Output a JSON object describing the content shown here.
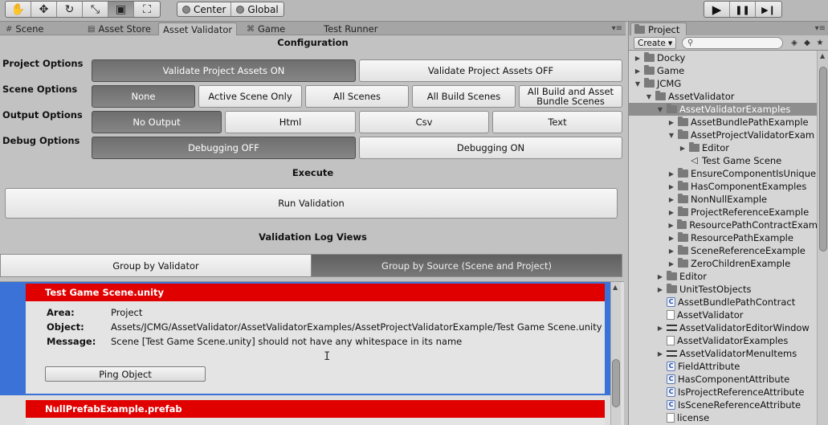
{
  "toolbar": {
    "transform_tools": [
      {
        "icon": "hand-icon",
        "glyph": "✋"
      },
      {
        "icon": "move-icon",
        "glyph": "✥"
      },
      {
        "icon": "rotate-icon",
        "glyph": "↻"
      },
      {
        "icon": "scale-icon",
        "glyph": "⤡"
      },
      {
        "icon": "rect-icon",
        "glyph": "▣"
      },
      {
        "icon": "transform-icon",
        "glyph": "⛶"
      }
    ],
    "pivot": "Center",
    "space": "Global",
    "play_glyph": "▶",
    "pause_glyph": "❚❚",
    "step_glyph": "▶❙"
  },
  "tabs": {
    "scene": "Scene",
    "asset_store": "Asset Store",
    "asset_validator": "Asset Validator",
    "game": "Game",
    "test_runner": "Test Runner",
    "menu_glyph": "▾≡"
  },
  "validator": {
    "configuration_heading": "Configuration",
    "project_options": {
      "label": "Project Options",
      "buttons": [
        "Validate Project Assets ON",
        "Validate Project Assets OFF"
      ],
      "selected": "Validate Project Assets ON"
    },
    "scene_options": {
      "label": "Scene Options",
      "buttons": [
        "None",
        "Active Scene Only",
        "All Scenes",
        "All Build Scenes",
        "All Build and Asset Bundle Scenes"
      ],
      "selected": "None"
    },
    "output_options": {
      "label": "Output Options",
      "buttons": [
        "No Output",
        "Html",
        "Csv",
        "Text"
      ],
      "selected": "No Output"
    },
    "debug_options": {
      "label": "Debug Options",
      "buttons": [
        "Debugging OFF",
        "Debugging ON"
      ],
      "selected": "Debugging OFF"
    },
    "execute_heading": "Execute",
    "run_validation": "Run Validation",
    "log_views_heading": "Validation Log Views",
    "group_by_validator": "Group by Validator",
    "group_by_source": "Group by Source (Scene and Project)",
    "selected_group": "Group by Source (Scene and Project)"
  },
  "log": {
    "entries": [
      {
        "title": "Test Game Scene.unity",
        "area_label": "Area:",
        "area": "Project",
        "object_label": "Object:",
        "object": "Assets/JCMG/AssetValidator/AssetValidatorExamples/AssetProjectValidatorExample/Test Game Scene.unity",
        "message_label": "Message:",
        "message": "Scene [Test Game Scene.unity] should not have any whitespace in its name",
        "ping": "Ping Object"
      },
      {
        "title": "NullPrefabExample.prefab"
      }
    ],
    "error_color": "#e00000",
    "selection_color": "#3a72d8"
  },
  "project": {
    "tab": "Project",
    "create": "Create",
    "search_placeholder": "",
    "tree": [
      {
        "label": "Docky",
        "type": "folder",
        "depth": 0,
        "arrow": "▶"
      },
      {
        "label": "Game",
        "type": "folder",
        "depth": 0,
        "arrow": "▶"
      },
      {
        "label": "JCMG",
        "type": "folder",
        "depth": 0,
        "arrow": "▼"
      },
      {
        "label": "AssetValidator",
        "type": "folder",
        "depth": 1,
        "arrow": "▼"
      },
      {
        "label": "AssetValidatorExamples",
        "type": "folder",
        "depth": 2,
        "arrow": "▼",
        "selected": true
      },
      {
        "label": "AssetBundlePathExample",
        "type": "folder",
        "depth": 3,
        "arrow": "▶"
      },
      {
        "label": "AssetProjectValidatorExam",
        "type": "folder",
        "depth": 3,
        "arrow": "▼"
      },
      {
        "label": "Editor",
        "type": "folder",
        "depth": 4,
        "arrow": "▶"
      },
      {
        "label": "Test Game Scene",
        "type": "unity",
        "depth": 4,
        "arrow": ""
      },
      {
        "label": "EnsureComponentIsUnique",
        "type": "folder",
        "depth": 3,
        "arrow": "▶"
      },
      {
        "label": "HasComponentExamples",
        "type": "folder",
        "depth": 3,
        "arrow": "▶"
      },
      {
        "label": "NonNullExample",
        "type": "folder",
        "depth": 3,
        "arrow": "▶"
      },
      {
        "label": "ProjectReferenceExample",
        "type": "folder",
        "depth": 3,
        "arrow": "▶"
      },
      {
        "label": "ResourcePathContractExam",
        "type": "folder",
        "depth": 3,
        "arrow": "▶"
      },
      {
        "label": "ResourcePathExample",
        "type": "folder",
        "depth": 3,
        "arrow": "▶"
      },
      {
        "label": "SceneReferenceExample",
        "type": "folder",
        "depth": 3,
        "arrow": "▶"
      },
      {
        "label": "ZeroChildrenExample",
        "type": "folder",
        "depth": 3,
        "arrow": "▶"
      },
      {
        "label": "Editor",
        "type": "folder",
        "depth": 2,
        "arrow": "▶"
      },
      {
        "label": "UnitTestObjects",
        "type": "folder",
        "depth": 2,
        "arrow": "▶"
      },
      {
        "label": "AssetBundlePathContract",
        "type": "script",
        "depth": 2,
        "arrow": ""
      },
      {
        "label": "AssetValidator",
        "type": "doc",
        "depth": 2,
        "arrow": ""
      },
      {
        "label": "AssetValidatorEditorWindow",
        "type": "menuitem",
        "depth": 2,
        "arrow": "▶"
      },
      {
        "label": "AssetValidatorExamples",
        "type": "doc",
        "depth": 2,
        "arrow": ""
      },
      {
        "label": "AssetValidatorMenuItems",
        "type": "menuitem",
        "depth": 2,
        "arrow": "▶"
      },
      {
        "label": "FieldAttribute",
        "type": "script",
        "depth": 2,
        "arrow": ""
      },
      {
        "label": "HasComponentAttribute",
        "type": "script",
        "depth": 2,
        "arrow": ""
      },
      {
        "label": "IsProjectReferenceAttribute",
        "type": "script",
        "depth": 2,
        "arrow": ""
      },
      {
        "label": "IsSceneReferenceAttribute",
        "type": "script",
        "depth": 2,
        "arrow": ""
      },
      {
        "label": "license",
        "type": "doc",
        "depth": 2,
        "arrow": ""
      }
    ]
  }
}
